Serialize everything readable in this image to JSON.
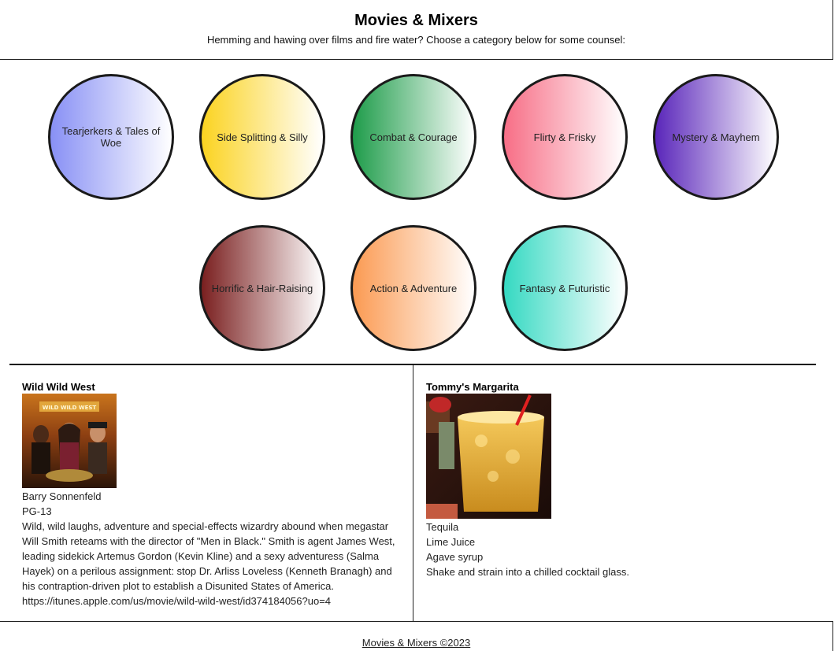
{
  "header": {
    "title": "Movies & Mixers",
    "subtitle": "Hemming and hawing over films and fire water? Choose a category below for some counsel:"
  },
  "categories": [
    {
      "label": "Tearjerkers & Tales of Woe",
      "color": "#8890f5"
    },
    {
      "label": "Side Splitting & Silly",
      "color": "#fbd320"
    },
    {
      "label": "Combat & Courage",
      "color": "#1e9c4a"
    },
    {
      "label": "Flirty & Frisky",
      "color": "#f76e86"
    },
    {
      "label": "Mystery & Mayhem",
      "color": "#5a26ba"
    },
    {
      "label": "Horrific & Hair-Raising",
      "color": "#7a1f1f"
    },
    {
      "label": "Action & Adventure",
      "color": "#fb9a52"
    },
    {
      "label": "Fantasy & Futuristic",
      "color": "#35d9c2"
    }
  ],
  "movie": {
    "title": "Wild Wild West",
    "poster_text": "WILD WILD WEST",
    "director": "Barry Sonnenfeld",
    "rating": "PG-13",
    "description": "Wild, wild laughs, adventure and special-effects wizardry abound when megastar Will Smith reteams with the director of \"Men in Black.\" Smith is agent James West, leading sidekick Artemus Gordon (Kevin Kline) and a sexy adventuress (Salma Hayek) on a perilous assignment: stop Dr. Arliss Loveless (Kenneth Branagh) and his contraption-driven plot to establish a Disunited States of America.",
    "link": "https://itunes.apple.com/us/movie/wild-wild-west/id374184056?uo=4"
  },
  "drink": {
    "title": "Tommy's Margarita",
    "ingredients": [
      "Tequila",
      "Lime Juice",
      "Agave syrup"
    ],
    "instructions": "Shake and strain into a chilled cocktail glass."
  },
  "footer": {
    "text": "Movies & Mixers ©2023"
  }
}
